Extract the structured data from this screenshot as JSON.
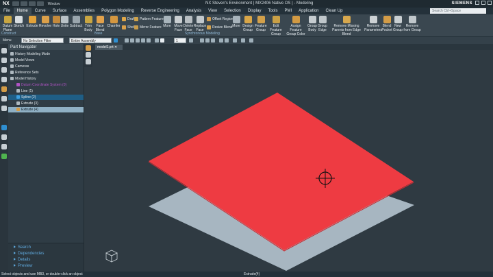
{
  "title_bar": {
    "logo": "NX",
    "window_menu": "Window",
    "title": "NX Steven's Environment | MX2406 Native OS | - Modeling",
    "brand": "SIEMENS"
  },
  "menu": {
    "items": [
      "File",
      "Home",
      "Curve",
      "Surface",
      "Assemblies",
      "Polygon Modeling",
      "Reverse Engineering",
      "Analysis",
      "View",
      "Selection",
      "Display",
      "Tools",
      "PMI",
      "Application",
      "Clean Up"
    ],
    "active": "Home",
    "search_placeholder": "Search Ctrl+Space"
  },
  "ribbon": {
    "construct": {
      "label": "Construct",
      "buttons": [
        "Datum Plane",
        "Sketch",
        "Extrude",
        "Revolve",
        "Hole",
        "Unite",
        "Subtract",
        "Trim Body",
        "Face Blend",
        "Chamfer"
      ]
    },
    "base": {
      "label": "Base",
      "small": [
        "Draft",
        "Shell",
        "Pattern Feature",
        "Mirror Feature"
      ],
      "more": "More"
    },
    "synchronous": {
      "label": "Synchronous Modeling",
      "buttons": [
        "Move Face",
        "Delete Face",
        "Replace Face"
      ],
      "small": [
        "Offset Region",
        "Resize Blend"
      ],
      "more": "More"
    },
    "feature": {
      "buttons": [
        "Design Group",
        "Feature Group",
        "Edit Feature Group",
        "Assign Feature Group Color",
        "Group Body",
        "Group Edge",
        "Remove Missing Parents from Edge Blend",
        "Remove Parameters",
        "Blend Pocket",
        "New Group",
        "Remove from Group"
      ]
    }
  },
  "filter_bar": {
    "menu": "Menu",
    "selection_filter": "No Selection Filter",
    "assembly_scope": "Entire Assembly",
    "layer": "1"
  },
  "part_navigator": {
    "title": "Part Navigator",
    "nodes": [
      {
        "label": "History Modeling Mode",
        "indent": 0,
        "state": "normal"
      },
      {
        "label": "Model Views",
        "indent": 0,
        "state": "normal"
      },
      {
        "label": "Cameras",
        "indent": 0,
        "state": "normal"
      },
      {
        "label": "Reference Sets",
        "indent": 0,
        "state": "normal"
      },
      {
        "label": "Model History",
        "indent": 0,
        "state": "normal"
      },
      {
        "label": "Datum Coordinate System (0)",
        "indent": 1,
        "state": "suppressed"
      },
      {
        "label": "Line (1)",
        "indent": 1,
        "state": "normal"
      },
      {
        "label": "Spline (2)",
        "indent": 1,
        "state": "selected"
      },
      {
        "label": "Extrude (3)",
        "indent": 1,
        "state": "normal"
      },
      {
        "label": "Extrude (4)",
        "indent": 1,
        "state": "highlight"
      }
    ],
    "details": [
      "Search",
      "Dependencies",
      "Details",
      "Preview"
    ]
  },
  "viewport": {
    "tab_label": "model1.prt",
    "plate_color": "#ee3b42",
    "plane_color": "#a7b6c1",
    "background": "#2f3a42"
  },
  "status": {
    "prompt": "Select objects and use MB3, or double-click an object",
    "selection": "Extrude(4)"
  },
  "colors": {
    "accent": "#1f5e86",
    "link": "#5fa9dd",
    "ribbon": "#3a4750"
  }
}
